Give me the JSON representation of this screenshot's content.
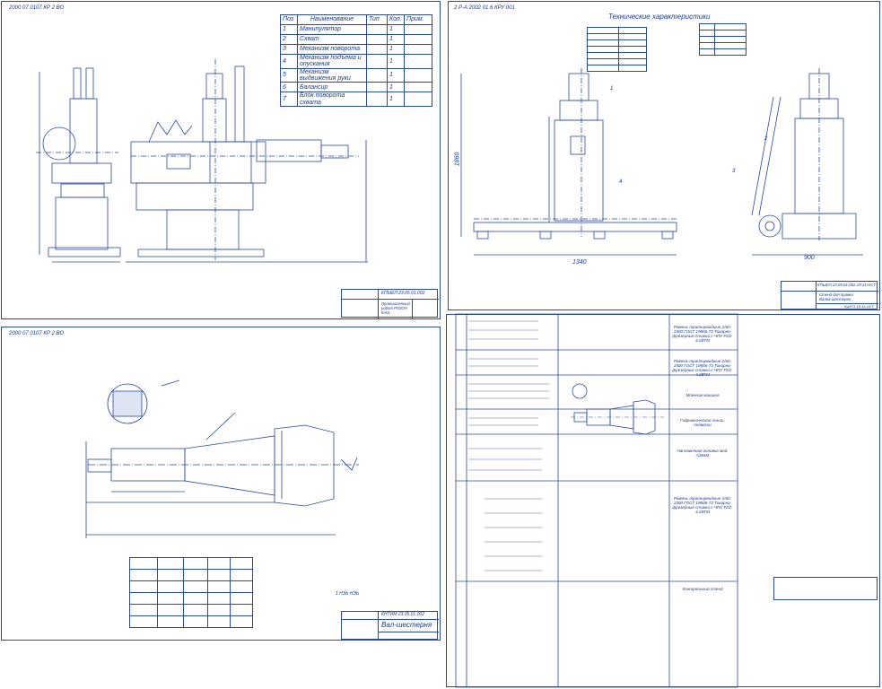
{
  "sheet1": {
    "stamp": "2000 07 0107 КР 2 ВО",
    "spec_headers": [
      "Поз",
      "Наименование",
      "Тип",
      "Кол.",
      "Прим."
    ],
    "spec_rows": [
      {
        "pos": "1",
        "name": "Манипулятор",
        "qty": "1"
      },
      {
        "pos": "2",
        "name": "Схват",
        "qty": "1"
      },
      {
        "pos": "3",
        "name": "Механизм поворота",
        "qty": "1"
      },
      {
        "pos": "4",
        "name": "Механизм подъема и опускания",
        "qty": "1"
      },
      {
        "pos": "5",
        "name": "Механизм выдвижения руки",
        "qty": "1"
      },
      {
        "pos": "6",
        "name": "Балансир",
        "qty": "1"
      },
      {
        "pos": "7",
        "name": "Блок поворота схвата",
        "qty": "1"
      }
    ],
    "title_code": "КПЫЕЛ 23.05.01.002",
    "title_name": "Промышленный робот РОЗОН 6А01"
  },
  "sheet2": {
    "stamp": "2 Р-А 2002 01 6 КРУ 001",
    "heading": "Технические характеристики",
    "dim_height": "1860",
    "dim_width": "1340",
    "dim_depth": "900",
    "callouts": [
      "1",
      "2",
      "3",
      "4"
    ],
    "title_code": "КПЫЕЛ 23.05.01.002 19-11-НСТ",
    "title_name": "Стенд для правки Валов шестерен",
    "title_org": "КуИТЭ 19-11-НСТ"
  },
  "sheet3": {
    "stamp": "2000 07 0107 КР 2 ВО",
    "title_code": "КНТИМ 23.05.01.002",
    "title_name": "Вал-шестерня",
    "roughness_note": "1 НЭЬ НЭЬ"
  },
  "sheet4": {
    "routing_right": [
      "Ремень трапецевидные 2/60-1500 ГОСТ 19866-73 Токарно-фрезерные станки с ЧПУ FD2-4.2ВТМ",
      "Ремень трапецевидные 2/60-1500 ГОСТ 19866-73 Токарно-фрезерные станки с ЧПУ FD2-4.2ВТМ",
      "Моечная машина",
      "Гидравлические линии, подвески",
      "Наплавочная головка мод. А384М",
      "Ремень трапецевидные 2/60-1500 ГОСТ 19866-73 Токарно-фрезерные станки с ЧПУ FD2-4.2ВТМ",
      "Контрольный стенд"
    ]
  },
  "colors": {
    "line": "#2a4aa0",
    "text": "#1a3a8a",
    "paper": "#ffffff",
    "bg": "#ffffff"
  }
}
